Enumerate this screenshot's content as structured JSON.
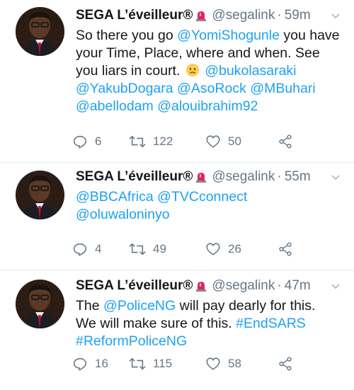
{
  "tweets": [
    {
      "name": "SEGA L’éveilleur®",
      "handle": "@segalink",
      "dot": "·",
      "time": "59m",
      "lines": [
        [
          {
            "t": "So there you go "
          },
          {
            "t": "@YomiShogunle",
            "link": true
          },
          {
            "t": " you have"
          }
        ],
        [
          {
            "t": "your Time, Place, where and when. See"
          }
        ],
        [
          {
            "t": "you liars in court. "
          },
          {
            "emoji": "worried-face"
          },
          {
            "t": " "
          },
          {
            "t": "@bukolasaraki",
            "link": true
          }
        ],
        [
          {
            "t": "@YakubDogara",
            "link": true
          },
          {
            "t": " "
          },
          {
            "t": "@AsoRock",
            "link": true
          },
          {
            "t": " "
          },
          {
            "t": "@MBuhari",
            "link": true
          }
        ],
        [
          {
            "t": "@abellodam",
            "link": true
          },
          {
            "t": " "
          },
          {
            "t": "@alouibrahim92",
            "link": true
          }
        ]
      ],
      "replies": "6",
      "retweets": "122",
      "likes": "50"
    },
    {
      "name": "SEGA L’éveilleur®",
      "handle": "@segalink",
      "dot": "·",
      "time": "55m",
      "lines": [
        [
          {
            "t": "@BBCAfrica",
            "link": true
          },
          {
            "t": " "
          },
          {
            "t": "@TVCconnect",
            "link": true
          }
        ],
        [
          {
            "t": "@oluwaloninyo",
            "link": true
          }
        ]
      ],
      "replies": "4",
      "retweets": "49",
      "likes": "26"
    },
    {
      "name": "SEGA L’éveilleur®",
      "handle": "@segalink",
      "dot": "·",
      "time": "47m",
      "lines": [
        [
          {
            "t": "The "
          },
          {
            "t": "@PoliceNG",
            "link": true
          },
          {
            "t": " will pay dearly for this."
          }
        ],
        [
          {
            "t": "We will make sure of this. "
          },
          {
            "t": "#EndSARS",
            "link": true
          }
        ],
        [
          {
            "t": "#ReformPoliceNG",
            "link": true
          }
        ]
      ],
      "replies": "16",
      "retweets": "115",
      "likes": "58"
    }
  ],
  "icons": {
    "badge": "police-light-icon",
    "caret": "chevron-down-icon",
    "reply": "reply-icon",
    "retweet": "retweet-icon",
    "like": "heart-icon",
    "share": "share-icon"
  },
  "colors": {
    "link": "#1da1f2",
    "secondary": "#657786",
    "text": "#14171a"
  }
}
